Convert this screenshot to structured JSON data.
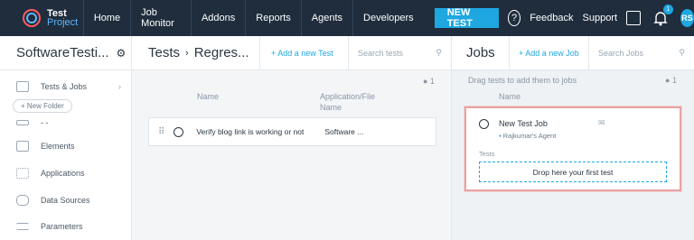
{
  "logo": {
    "line1": "Test",
    "line2": "Project"
  },
  "nav": {
    "items": [
      "Home",
      "Job Monitor",
      "Addons",
      "Reports",
      "Agents",
      "Developers"
    ],
    "new_test": "NEW TEST",
    "help": "?",
    "feedback": "Feedback",
    "support": "Support",
    "notif_count": "1",
    "avatar": "RS"
  },
  "left": {
    "project": "SoftwareTesti...",
    "tests_jobs": "Tests & Jobs",
    "new_folder": "+ New Folder",
    "dots": "- -",
    "elements": "Elements",
    "applications": "Applications",
    "data_sources": "Data Sources",
    "parameters": "Parameters"
  },
  "mid": {
    "crumb_root": "Tests",
    "crumb_sep": "›",
    "crumb_current": "Regres...",
    "add_test": "+ Add a new Test",
    "search_placeholder": "Search tests",
    "count": "1",
    "col_name": "Name",
    "col_app": "Application/File",
    "col_app2": "Name",
    "row": {
      "name": "Verify blog link is working or not",
      "app": "Software ..."
    }
  },
  "right": {
    "title": "Jobs",
    "add_job": "+ Add a new Job",
    "search_placeholder": "Search Jobs",
    "hint": "Drag tests to add them to jobs",
    "count": "1",
    "col_name": "Name",
    "job": {
      "name": "New Test Job",
      "agent": "Rajkumar's Agent",
      "tests_label": "Tests",
      "drop": "Drop here your first test"
    }
  }
}
